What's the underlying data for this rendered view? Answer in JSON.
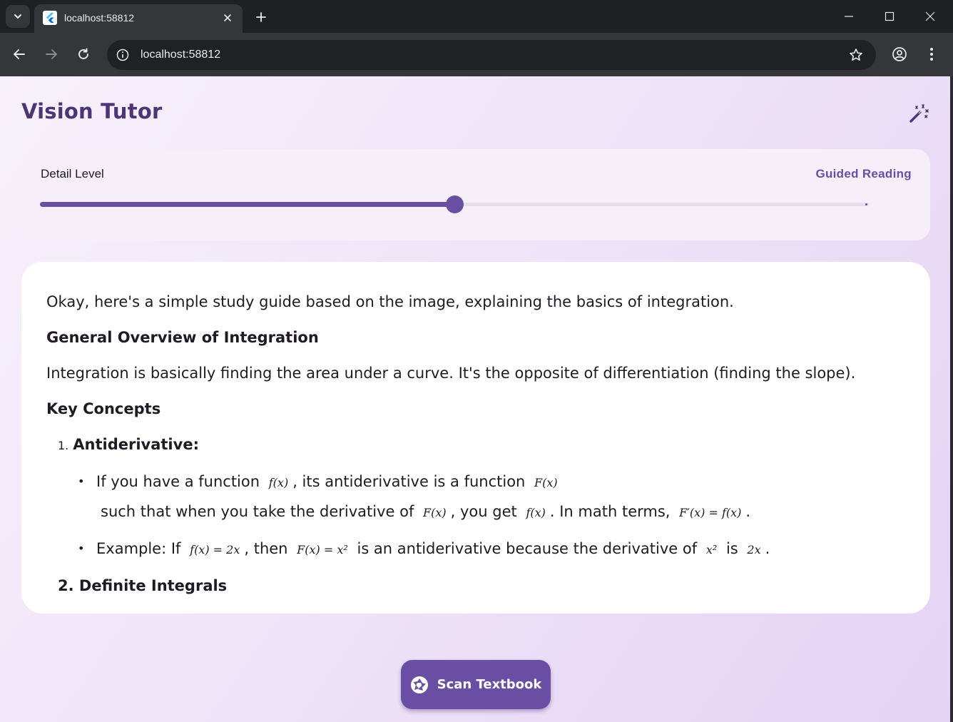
{
  "browser": {
    "tab_title": "localhost:58812",
    "url": "localhost:58812"
  },
  "app": {
    "title": "Vision Tutor",
    "accent_color": "#6a4ea3",
    "title_color": "#4b3574"
  },
  "detail_level": {
    "label": "Detail Level",
    "mode": "Guided Reading",
    "value_fraction": 0.5
  },
  "content": {
    "intro": "Okay, here's a simple study guide based on the image, explaining the basics of integration.",
    "h1": "General Overview of Integration",
    "p1": "Integration is basically finding the area under a curve. It's the opposite of differentiation (finding the slope).",
    "h2": "Key Concepts",
    "item1_num": "1.",
    "item1_title": "Antiderivative:",
    "b1_a": "If you have a function",
    "b1_m1": "f(x)",
    "b1_b": ", its antiderivative is a function",
    "b1_m2": "F(x)",
    "b1_c": "such that when you take the derivative of",
    "b1_m3": "F(x)",
    "b1_d": ", you get",
    "b1_m4": "f(x)",
    "b1_e": ".  In math terms,",
    "b1_m5": "F′(x) = f(x)",
    "b1_f": ".",
    "b2_a": "Example: If",
    "b2_m1": "f(x) = 2x",
    "b2_b": ", then",
    "b2_m2": "F(x) = x²",
    "b2_c": "is an antiderivative because the derivative of",
    "b2_m3": "x²",
    "b2_d": "is",
    "b2_m4": "2x",
    "b2_e": ".",
    "item2_partial": "2. Definite Integrals"
  },
  "actions": {
    "scan_label": "Scan Textbook"
  },
  "icons": {
    "tab_search": "chevron-down-icon",
    "magic": "magic-wand-icon",
    "scan": "camera-shutter-icon"
  }
}
